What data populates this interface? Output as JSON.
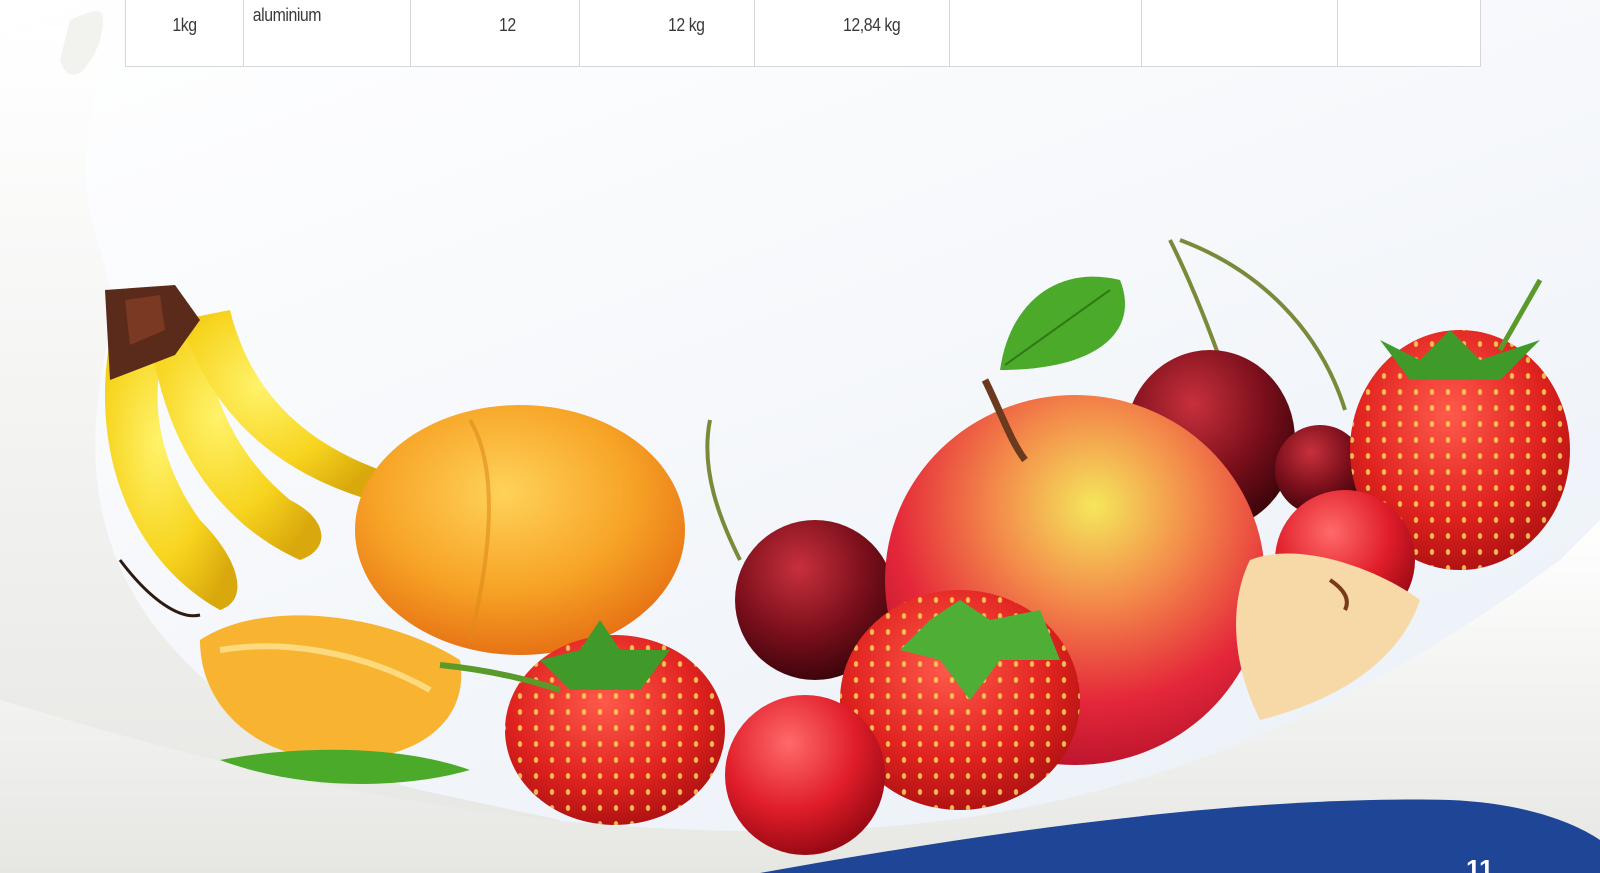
{
  "table": {
    "row": {
      "size": "1kg",
      "material": "aluminium",
      "units": "12",
      "net_weight": "12 kg",
      "gross_weight": "12,84 kg",
      "col6": "",
      "col7": "",
      "col8": ""
    }
  },
  "footer": {
    "page_number": "11"
  },
  "illustration": {
    "name": "fruits-in-milk-splash",
    "accent_color": "#1f4596"
  }
}
